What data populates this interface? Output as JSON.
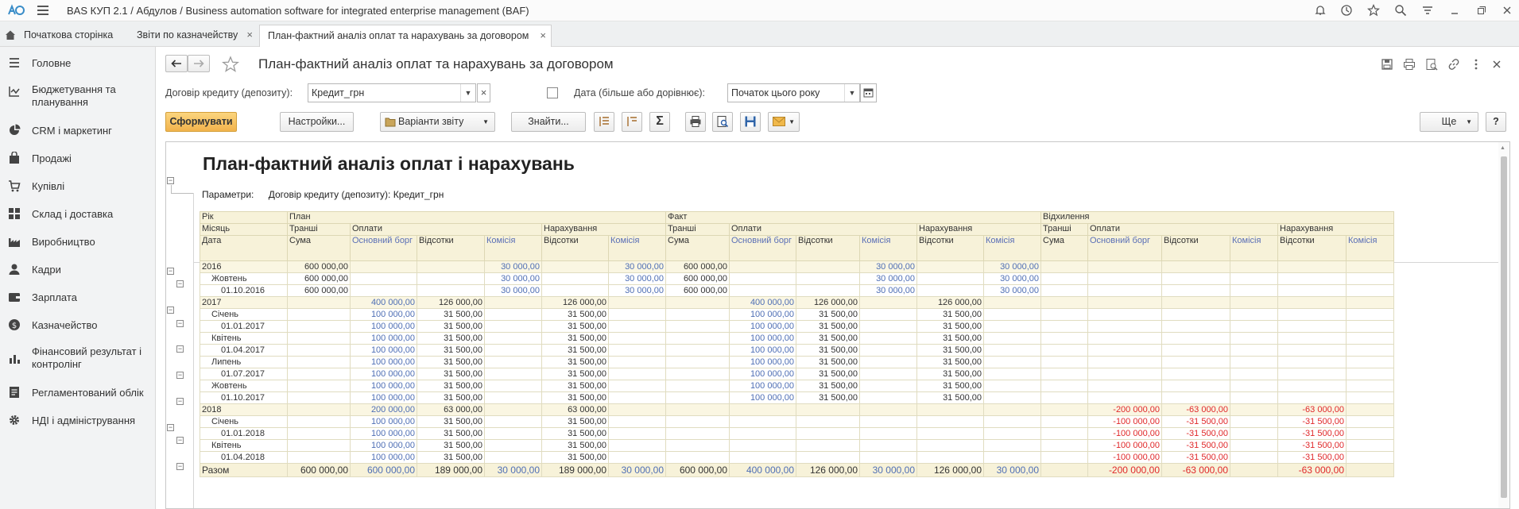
{
  "app": {
    "title": "BAS КУП 2.1 / Абдулов / Business automation software for integrated enterprise management  (BAF)"
  },
  "tabs": [
    {
      "label": "Початкова сторінка"
    },
    {
      "label": "Звіти по казначейству"
    },
    {
      "label": "План-фактний аналіз оплат та нарахувань за договором"
    }
  ],
  "sidebar": {
    "items": [
      {
        "label": "Головне"
      },
      {
        "label": "Бюджетування та планування"
      },
      {
        "label": "CRM і маркетинг"
      },
      {
        "label": "Продажі"
      },
      {
        "label": "Купівлі"
      },
      {
        "label": "Склад і доставка"
      },
      {
        "label": "Виробництво"
      },
      {
        "label": "Кадри"
      },
      {
        "label": "Зарплата"
      },
      {
        "label": "Казначейство"
      },
      {
        "label": "Фінансовий результат і контролінг"
      },
      {
        "label": "Регламентований облік"
      },
      {
        "label": "НДІ і адміністрування"
      }
    ]
  },
  "form": {
    "title": "План-фактний аналіз оплат та нарахувань за договором",
    "contract_label": "Договір кредиту (депозиту):",
    "contract_value": "Кредит_грн",
    "date_label": "Дата (більше або дорівнює):",
    "date_value": "Початок цього року",
    "toolbar": {
      "generate": "Сформувати",
      "settings": "Настройки...",
      "variants": "Варіанти звіту",
      "find": "Знайти...",
      "more": "Ще",
      "help": "?"
    }
  },
  "report": {
    "title": "План-фактний аналіз оплат і нарахувань",
    "params_label": "Параметри:",
    "params_value": "Договір кредиту (депозиту): Кредит_грн",
    "header": {
      "row1": [
        "Рік",
        "План",
        "Факт",
        "Відхилення"
      ],
      "row2": [
        "Місяць",
        "Транші",
        "Оплати",
        "Нарахування",
        "Транші",
        "Оплати",
        "Нарахування",
        "Транші",
        "Оплати",
        "Нарахування"
      ],
      "row3": [
        "Дата",
        "Сума",
        "Основний борг",
        "Відсотки",
        "Комісія",
        "Відсотки",
        "Комісія",
        "Сума",
        "Основний борг",
        "Відсотки",
        "Комісія",
        "Відсотки",
        "Комісія",
        "Сума",
        "Основний борг",
        "Відсотки",
        "Комісія",
        "Відсотки",
        "Комісія"
      ]
    },
    "rows": [
      {
        "label": "2016",
        "level": 0,
        "cells": [
          "600 000,00",
          "",
          "",
          "30 000,00",
          "",
          "30 000,00",
          "600 000,00",
          "",
          "",
          "30 000,00",
          "",
          "30 000,00",
          "",
          "",
          "",
          "",
          "",
          ""
        ]
      },
      {
        "label": "Жовтень",
        "level": 1,
        "cells": [
          "600 000,00",
          "",
          "",
          "30 000,00",
          "",
          "30 000,00",
          "600 000,00",
          "",
          "",
          "30 000,00",
          "",
          "30 000,00",
          "",
          "",
          "",
          "",
          "",
          ""
        ]
      },
      {
        "label": "01.10.2016",
        "level": 2,
        "cells": [
          "600 000,00",
          "",
          "",
          "30 000,00",
          "",
          "30 000,00",
          "600 000,00",
          "",
          "",
          "30 000,00",
          "",
          "30 000,00",
          "",
          "",
          "",
          "",
          "",
          ""
        ]
      },
      {
        "label": "2017",
        "level": 0,
        "cells": [
          "",
          "400 000,00",
          "126 000,00",
          "",
          "126 000,00",
          "",
          "",
          "400 000,00",
          "126 000,00",
          "",
          "126 000,00",
          "",
          "",
          "",
          "",
          "",
          "",
          ""
        ]
      },
      {
        "label": "Січень",
        "level": 1,
        "cells": [
          "",
          "100 000,00",
          "31 500,00",
          "",
          "31 500,00",
          "",
          "",
          "100 000,00",
          "31 500,00",
          "",
          "31 500,00",
          "",
          "",
          "",
          "",
          "",
          "",
          ""
        ]
      },
      {
        "label": "01.01.2017",
        "level": 2,
        "cells": [
          "",
          "100 000,00",
          "31 500,00",
          "",
          "31 500,00",
          "",
          "",
          "100 000,00",
          "31 500,00",
          "",
          "31 500,00",
          "",
          "",
          "",
          "",
          "",
          "",
          ""
        ]
      },
      {
        "label": "Квітень",
        "level": 1,
        "cells": [
          "",
          "100 000,00",
          "31 500,00",
          "",
          "31 500,00",
          "",
          "",
          "100 000,00",
          "31 500,00",
          "",
          "31 500,00",
          "",
          "",
          "",
          "",
          "",
          "",
          ""
        ]
      },
      {
        "label": "01.04.2017",
        "level": 2,
        "cells": [
          "",
          "100 000,00",
          "31 500,00",
          "",
          "31 500,00",
          "",
          "",
          "100 000,00",
          "31 500,00",
          "",
          "31 500,00",
          "",
          "",
          "",
          "",
          "",
          "",
          ""
        ]
      },
      {
        "label": "Липень",
        "level": 1,
        "cells": [
          "",
          "100 000,00",
          "31 500,00",
          "",
          "31 500,00",
          "",
          "",
          "100 000,00",
          "31 500,00",
          "",
          "31 500,00",
          "",
          "",
          "",
          "",
          "",
          "",
          ""
        ]
      },
      {
        "label": "01.07.2017",
        "level": 2,
        "cells": [
          "",
          "100 000,00",
          "31 500,00",
          "",
          "31 500,00",
          "",
          "",
          "100 000,00",
          "31 500,00",
          "",
          "31 500,00",
          "",
          "",
          "",
          "",
          "",
          "",
          ""
        ]
      },
      {
        "label": "Жовтень",
        "level": 1,
        "cells": [
          "",
          "100 000,00",
          "31 500,00",
          "",
          "31 500,00",
          "",
          "",
          "100 000,00",
          "31 500,00",
          "",
          "31 500,00",
          "",
          "",
          "",
          "",
          "",
          "",
          ""
        ]
      },
      {
        "label": "01.10.2017",
        "level": 2,
        "cells": [
          "",
          "100 000,00",
          "31 500,00",
          "",
          "31 500,00",
          "",
          "",
          "100 000,00",
          "31 500,00",
          "",
          "31 500,00",
          "",
          "",
          "",
          "",
          "",
          "",
          ""
        ]
      },
      {
        "label": "2018",
        "level": 0,
        "cells": [
          "",
          "200 000,00",
          "63 000,00",
          "",
          "63 000,00",
          "",
          "",
          "",
          "",
          "",
          "",
          "",
          "",
          "-200 000,00",
          "-63 000,00",
          "",
          "-63 000,00",
          ""
        ]
      },
      {
        "label": "Січень",
        "level": 1,
        "cells": [
          "",
          "100 000,00",
          "31 500,00",
          "",
          "31 500,00",
          "",
          "",
          "",
          "",
          "",
          "",
          "",
          "",
          "-100 000,00",
          "-31 500,00",
          "",
          "-31 500,00",
          ""
        ]
      },
      {
        "label": "01.01.2018",
        "level": 2,
        "cells": [
          "",
          "100 000,00",
          "31 500,00",
          "",
          "31 500,00",
          "",
          "",
          "",
          "",
          "",
          "",
          "",
          "",
          "-100 000,00",
          "-31 500,00",
          "",
          "-31 500,00",
          ""
        ]
      },
      {
        "label": "Квітень",
        "level": 1,
        "cells": [
          "",
          "100 000,00",
          "31 500,00",
          "",
          "31 500,00",
          "",
          "",
          "",
          "",
          "",
          "",
          "",
          "",
          "-100 000,00",
          "-31 500,00",
          "",
          "-31 500,00",
          ""
        ]
      },
      {
        "label": "01.04.2018",
        "level": 2,
        "cells": [
          "",
          "100 000,00",
          "31 500,00",
          "",
          "31 500,00",
          "",
          "",
          "",
          "",
          "",
          "",
          "",
          "",
          "-100 000,00",
          "-31 500,00",
          "",
          "-31 500,00",
          ""
        ]
      }
    ],
    "total": {
      "label": "Разом",
      "cells": [
        "600 000,00",
        "600 000,00",
        "189 000,00",
        "30 000,00",
        "189 000,00",
        "30 000,00",
        "600 000,00",
        "400 000,00",
        "126 000,00",
        "30 000,00",
        "126 000,00",
        "30 000,00",
        "",
        "-200 000,00",
        "-63 000,00",
        "",
        "-63 000,00",
        ""
      ]
    }
  },
  "colors": {
    "header_bg": "#f7f2d9",
    "year_row_bg": "#faf6e2",
    "blue_text": "#4f6fb5",
    "red_text": "#e0282a",
    "primary_button": "#f2b34c"
  }
}
